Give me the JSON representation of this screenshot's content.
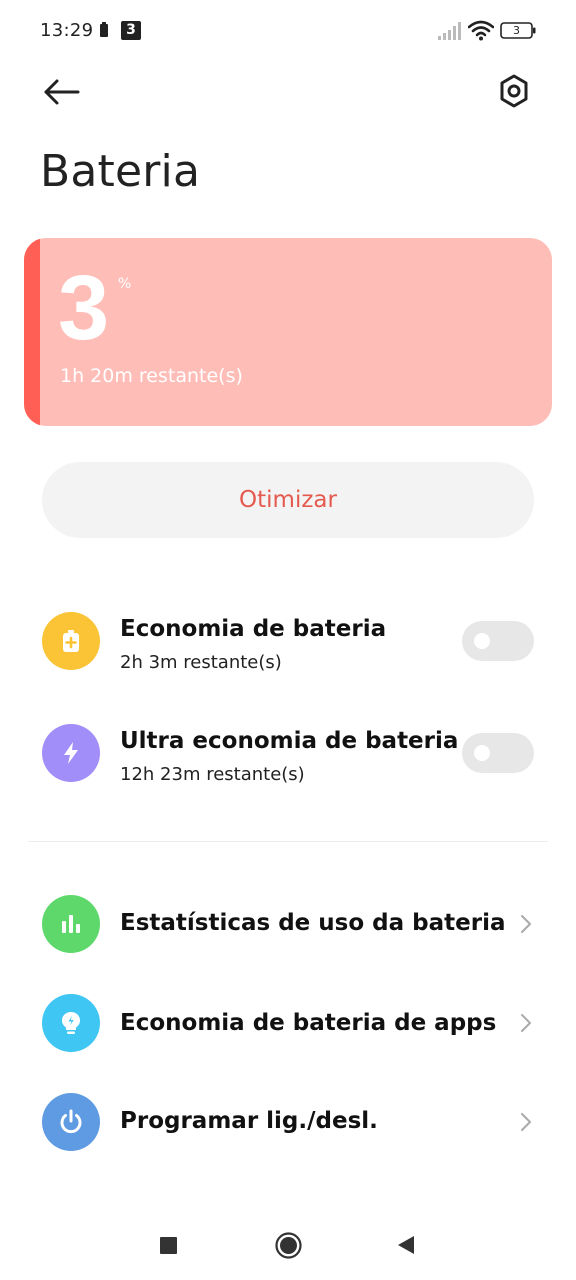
{
  "status_bar": {
    "time": "13:29",
    "sim_badge": "3",
    "battery_level": "3"
  },
  "header": {
    "title": "Bateria"
  },
  "battery_card": {
    "level": "3",
    "percent_sign": "%",
    "remaining": "1h 20m restante(s)",
    "color": "#ffbdb8",
    "accent_color": "#ff5f55"
  },
  "optimize_button": {
    "label": "Otimizar",
    "color": "#e55a4f"
  },
  "modes": [
    {
      "title": "Economia de bateria",
      "subtitle": "2h 3m restante(s)",
      "icon": "battery-plus-icon",
      "icon_color": "#fbc436",
      "enabled": false
    },
    {
      "title": "Ultra economia de bateria",
      "subtitle": "12h 23m restante(s)",
      "icon": "lightning-icon",
      "icon_color": "#a28ef8",
      "enabled": false
    }
  ],
  "menu": [
    {
      "title": "Estatísticas de uso da bateria",
      "icon": "bar-chart-icon",
      "icon_color": "#5ed86b"
    },
    {
      "title": "Economia de bateria de apps",
      "icon": "lightbulb-icon",
      "icon_color": "#40c6f2"
    },
    {
      "title": "Programar lig./desl.",
      "icon": "power-icon",
      "icon_color": "#5f9be2"
    }
  ]
}
